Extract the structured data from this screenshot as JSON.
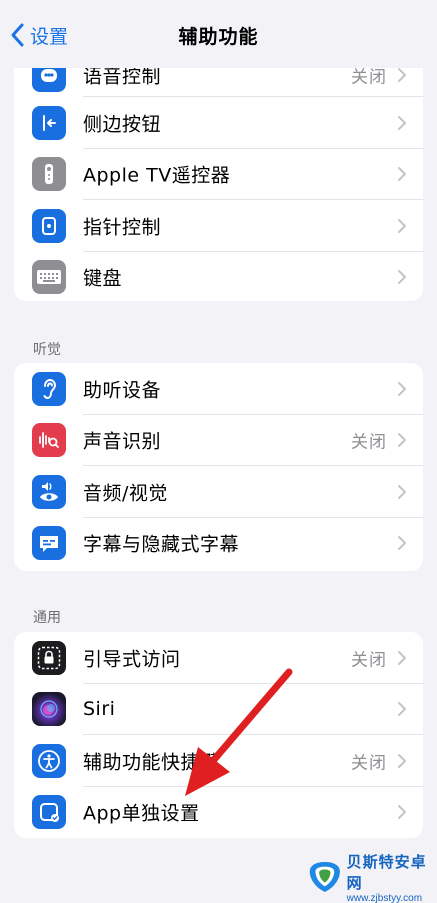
{
  "nav": {
    "back_label": "设置",
    "title": "辅助功能"
  },
  "groups": [
    {
      "header": "",
      "items": [
        {
          "label": "语音控制",
          "value": "关闭",
          "icon": "voice-control-icon"
        },
        {
          "label": "侧边按钮",
          "value": "",
          "icon": "side-button-icon"
        },
        {
          "label": "Apple TV遥控器",
          "value": "",
          "icon": "apple-tv-remote-icon"
        },
        {
          "label": "指针控制",
          "value": "",
          "icon": "pointer-control-icon"
        },
        {
          "label": "键盘",
          "value": "",
          "icon": "keyboard-icon"
        }
      ]
    },
    {
      "header": "听觉",
      "items": [
        {
          "label": "助听设备",
          "value": "",
          "icon": "hearing-device-icon"
        },
        {
          "label": "声音识别",
          "value": "关闭",
          "icon": "sound-recognition-icon"
        },
        {
          "label": "音频/视觉",
          "value": "",
          "icon": "audio-visual-icon"
        },
        {
          "label": "字幕与隐藏式字幕",
          "value": "",
          "icon": "subtitles-icon"
        }
      ]
    },
    {
      "header": "通用",
      "items": [
        {
          "label": "引导式访问",
          "value": "关闭",
          "icon": "guided-access-icon"
        },
        {
          "label": "Siri",
          "value": "",
          "icon": "siri-icon"
        },
        {
          "label": "辅助功能快捷键",
          "value": "关闭",
          "icon": "accessibility-shortcut-icon"
        },
        {
          "label": "App单独设置",
          "value": "",
          "icon": "per-app-settings-icon"
        }
      ]
    }
  ],
  "watermark": {
    "name": "贝斯特安卓网",
    "url": "www.zjbstyy.com"
  },
  "colors": {
    "accent": "#1a6fe0",
    "background": "#f2f2f7",
    "arrow": "#e02020"
  }
}
